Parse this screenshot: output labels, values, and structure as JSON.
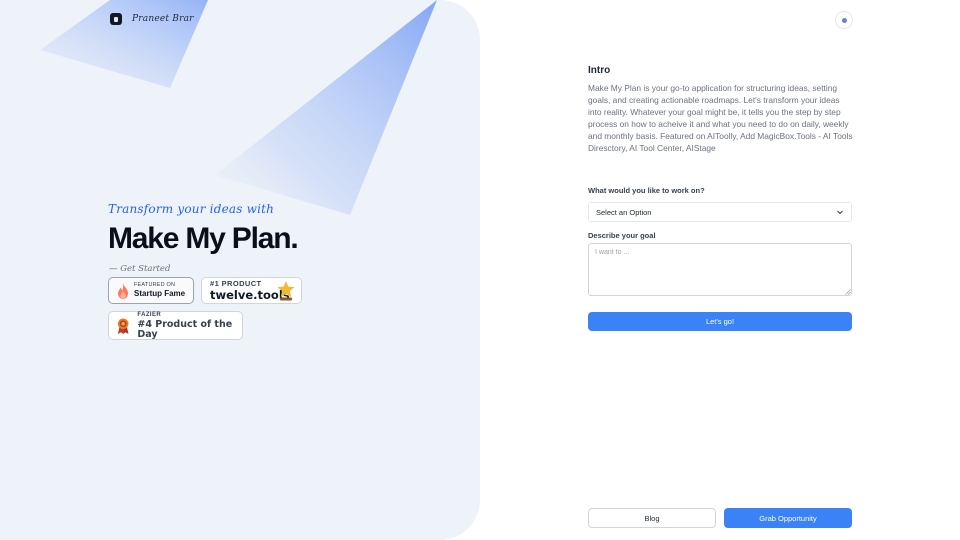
{
  "brand": {
    "name": "Praneet Brar"
  },
  "hero": {
    "tagline": "Transform your ideas with",
    "title": "Make My Plan.",
    "get_started": "— Get Started"
  },
  "badges": {
    "startup_fame": {
      "small": "FEATURED ON",
      "big": "Startup Fame",
      "icon": "flame-icon"
    },
    "twelve_tools": {
      "small": "#1 PRODUCT",
      "big": "twelve.tools",
      "icon": "star-trophy-icon"
    },
    "fazier": {
      "small": "FAZIER",
      "big": "#4 Product of the Day",
      "icon": "ribbon-medal-icon"
    }
  },
  "intro": {
    "heading": "Intro",
    "body": "Make My Plan is your go-to application for structuring ideas, setting goals, and creating actionable roadmaps. Let's transform your ideas into reality. Whatever your goal might be, it tells you the step by step process on how to acheive it and what you need to do on daily, weekly and monthly basis. Featured on AIToolly, Add MagicBox.Tools - AI Tools Diresctory, AI Tool Center, AIStage"
  },
  "form": {
    "work_label": "What would you like to work on?",
    "select_value": "Select an Option",
    "goal_label": "Describe your goal",
    "goal_placeholder": "I want to ...",
    "goal_value": "",
    "submit_label": "Let's go!"
  },
  "footer": {
    "blog_label": "Blog",
    "grab_label": "Grab Opportunity"
  },
  "colors": {
    "accent": "#3b82f6",
    "tagline": "#2563eb",
    "left_panel_bg": "#eef2f9",
    "beam": "#93b4f5"
  }
}
